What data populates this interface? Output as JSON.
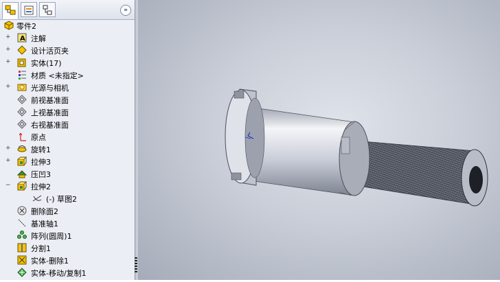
{
  "tabs": [
    {
      "name": "feature-manager",
      "icon": "feature-tree-icon"
    },
    {
      "name": "property-manager",
      "icon": "property-manager-icon"
    },
    {
      "name": "configuration-manager",
      "icon": "configuration-icon"
    }
  ],
  "collapse_label": "»",
  "tree": {
    "root": "零件2",
    "items": [
      {
        "label": "注解",
        "icon": "annotation-icon",
        "expand": "+"
      },
      {
        "label": "设计活页夹",
        "icon": "design-binder-icon",
        "expand": "+"
      },
      {
        "label": "实体(17)",
        "icon": "solid-bodies-icon",
        "expand": "+"
      },
      {
        "label": "材质 <未指定>",
        "icon": "material-icon",
        "expand": ""
      },
      {
        "label": "光源与相机",
        "icon": "lights-cameras-icon",
        "expand": "+"
      },
      {
        "label": "前视基准面",
        "icon": "plane-icon",
        "expand": ""
      },
      {
        "label": "上视基准面",
        "icon": "plane-icon",
        "expand": ""
      },
      {
        "label": "右视基准面",
        "icon": "plane-icon",
        "expand": ""
      },
      {
        "label": "原点",
        "icon": "origin-icon",
        "expand": ""
      },
      {
        "label": "旋转1",
        "icon": "revolve-icon",
        "expand": "+"
      },
      {
        "label": "拉伸3",
        "icon": "extrude-icon",
        "expand": "+"
      },
      {
        "label": "压凹3",
        "icon": "indent-icon",
        "expand": ""
      },
      {
        "label": "拉伸2",
        "icon": "extrude-icon",
        "expand": "−"
      },
      {
        "label": "(-) 草图2",
        "icon": "sketch-icon",
        "expand": ""
      },
      {
        "label": "删除面2",
        "icon": "delete-face-icon",
        "expand": ""
      },
      {
        "label": "基准轴1",
        "icon": "axis-icon",
        "expand": ""
      },
      {
        "label": "阵列(圆周)1",
        "icon": "circular-pattern-icon",
        "expand": ""
      },
      {
        "label": "分割1",
        "icon": "split-icon",
        "expand": ""
      },
      {
        "label": "实体-删除1",
        "icon": "body-delete-icon",
        "expand": ""
      },
      {
        "label": "实体-移动/复制1",
        "icon": "body-move-copy-icon",
        "expand": ""
      }
    ]
  },
  "colors": {
    "panel": "#ebeef4",
    "viewport_center": "#dfe3ea",
    "viewport_edge": "#a5abb8",
    "part_metal": "#c9cdd8"
  }
}
